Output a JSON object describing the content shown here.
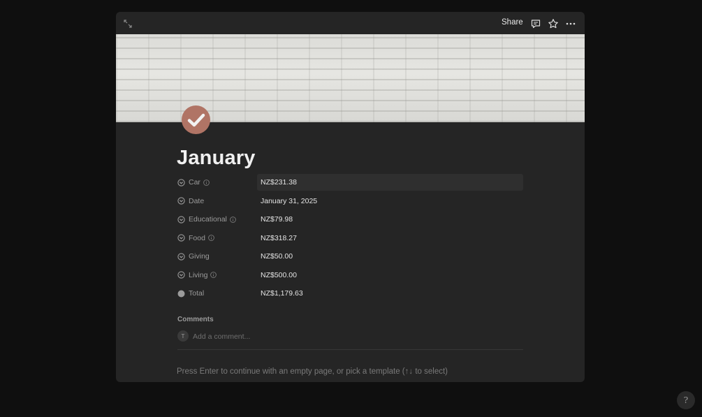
{
  "topbar": {
    "share_label": "Share",
    "icons": [
      "expand-icon",
      "comment-icon",
      "star-icon",
      "more-icon"
    ]
  },
  "page": {
    "icon": "check-circle-icon",
    "icon_color": "#b07465",
    "title": "January"
  },
  "properties": [
    {
      "name": "Car",
      "type_icon": "formula-icon",
      "has_info": true,
      "value": "NZ$231.38"
    },
    {
      "name": "Date",
      "type_icon": "formula-icon",
      "has_info": false,
      "value": "January 31, 2025"
    },
    {
      "name": "Educational",
      "type_icon": "formula-icon",
      "has_info": true,
      "value": "NZ$79.98"
    },
    {
      "name": "Food",
      "type_icon": "formula-icon",
      "has_info": true,
      "value": "NZ$318.27"
    },
    {
      "name": "Giving",
      "type_icon": "formula-icon",
      "has_info": false,
      "value": "NZ$50.00"
    },
    {
      "name": "Living",
      "type_icon": "formula-icon",
      "has_info": true,
      "value": "NZ$500.00"
    },
    {
      "name": "Total",
      "type_icon": "dot-icon",
      "has_info": false,
      "value": "NZ$1,179.63"
    }
  ],
  "comments": {
    "label": "Comments",
    "avatar_initial": "T",
    "placeholder": "Add a comment..."
  },
  "hint": "Press Enter to continue with an empty page, or pick a template (↑↓ to select)",
  "help_label": "?"
}
